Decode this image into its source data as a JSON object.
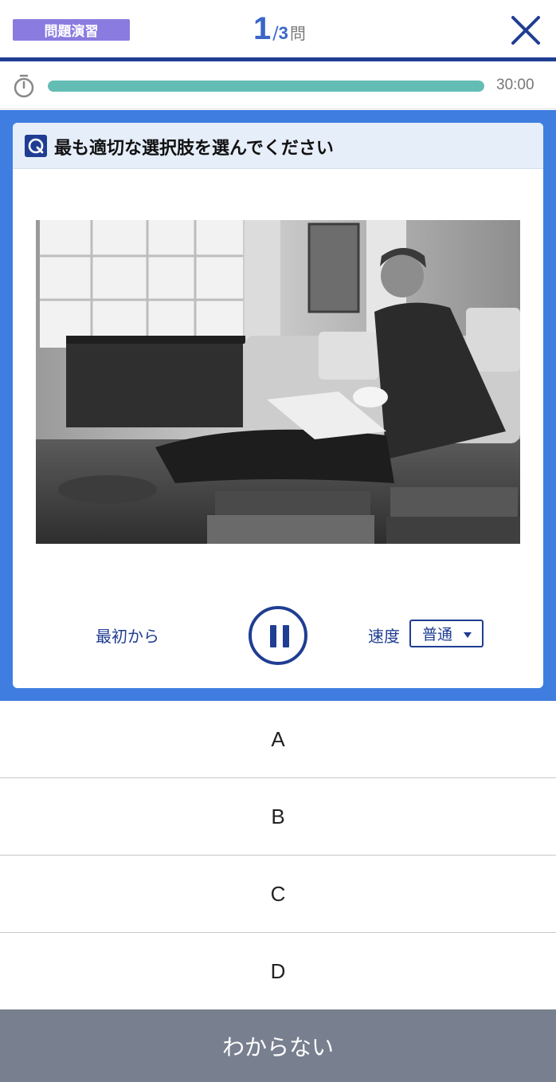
{
  "header": {
    "mode_badge": "問題演習",
    "question_current": "1",
    "question_separator": "/",
    "question_total": "3",
    "question_unit": "問",
    "close_icon": "close-x-icon"
  },
  "timer": {
    "icon": "stopwatch-icon",
    "remaining": "30:00",
    "progress_fraction": 1.0,
    "bar_color": "#63bdb4"
  },
  "question": {
    "icon": "question-q-icon",
    "prompt": "最も適切な選択肢を選んでください",
    "image_description_icon": "photo-man-reading-on-floor"
  },
  "controls": {
    "restart_label": "最初から",
    "pause_icon": "pause-icon",
    "speed_label": "速度",
    "speed_value": "普通"
  },
  "choices": [
    "A",
    "B",
    "C",
    "D"
  ],
  "footer": {
    "unknown_label": "わからない"
  },
  "colors": {
    "accent_blue": "#3f7ee0",
    "navy": "#1f3d92",
    "badge_purple": "#8a7be0",
    "footer_gray": "#78808f"
  }
}
